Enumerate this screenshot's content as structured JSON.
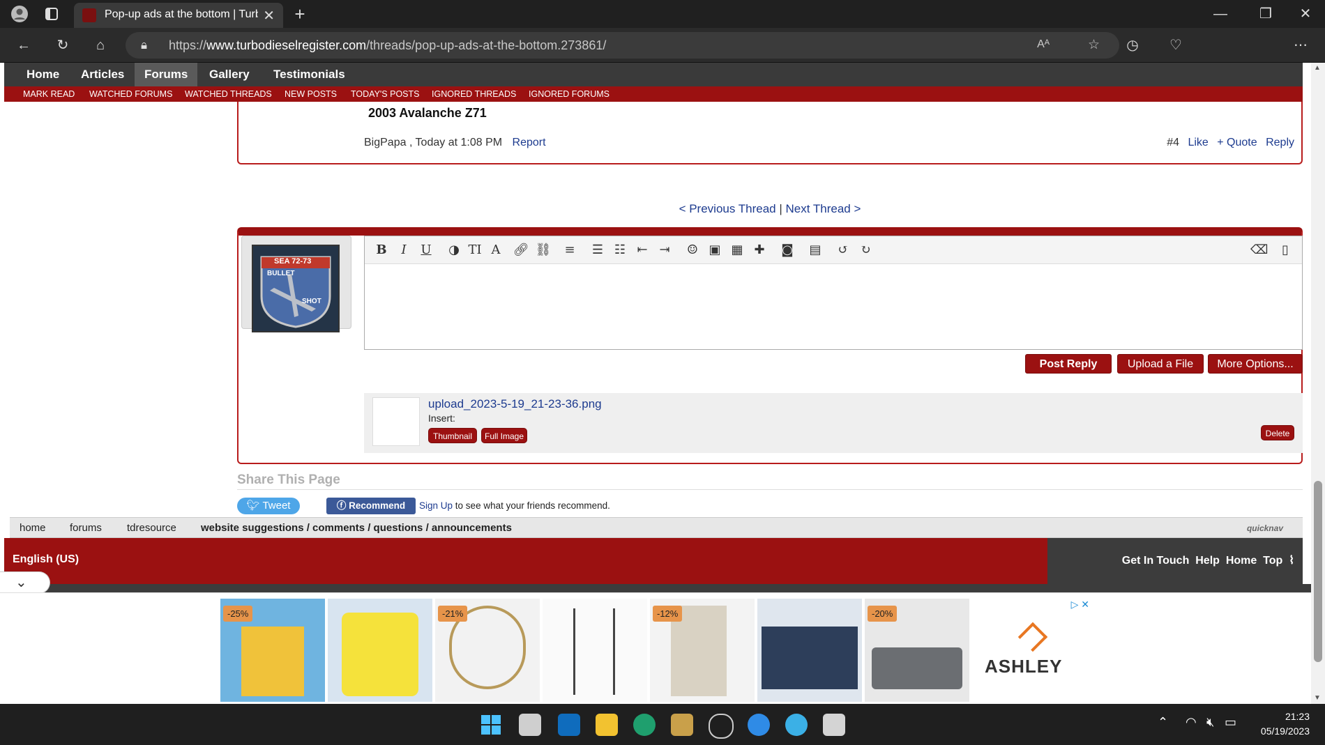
{
  "browser": {
    "tab_title": "Pop-up ads at the bottom | Turb",
    "url_prefix": "https://",
    "url_domain": "www.turbodieselregister.com",
    "url_path": "/threads/pop-up-ads-at-the-bottom.273861/",
    "read_aloud_label": "A͢"
  },
  "nav": {
    "items": [
      "Home",
      "Articles",
      "Forums",
      "Gallery",
      "Testimonials"
    ],
    "active": "Forums",
    "sub": [
      "MARK READ",
      "WATCHED FORUMS",
      "WATCHED THREADS",
      "NEW POSTS",
      "TODAY'S POSTS",
      "IGNORED THREADS",
      "IGNORED FORUMS"
    ]
  },
  "post": {
    "signature": "2003 Avalanche Z71",
    "author": "BigPapa",
    "time": "Today at 1:08 PM",
    "report": "Report",
    "number": "#4",
    "like": "Like",
    "quote": "+ Quote",
    "reply": "Reply"
  },
  "thread_nav": {
    "prev": "< Previous Thread",
    "sep": "|",
    "next": "Next Thread >"
  },
  "reply": {
    "avatar_text_top": "SEA 72-73",
    "avatar_text_1": "BULLET",
    "avatar_text_2": "SHOT",
    "post_reply": "Post Reply",
    "upload": "Upload a File",
    "more": "More Options...",
    "attachment": {
      "filename": "upload_2023-5-19_21-23-36.png",
      "insert_label": "Insert:",
      "thumbnail": "Thumbnail",
      "full_image": "Full Image",
      "delete": "Delete"
    }
  },
  "share": {
    "title": "Share This Page",
    "tweet": "Tweet",
    "recommend": "Recommend",
    "sign_up": "Sign Up",
    "fb_text": "to see what your friends recommend."
  },
  "breadcrumb": {
    "items": [
      "home",
      "forums",
      "tdresource",
      "website suggestions / comments / questions / announcements"
    ],
    "quicknav": "quicknav"
  },
  "footer": {
    "language": "English (US)",
    "links": [
      "Get In Touch",
      "Help",
      "Home",
      "Top"
    ]
  },
  "ads": {
    "badges": [
      "-25%",
      "-21%",
      "-12%",
      "-20%"
    ],
    "brand": "ASHLEY"
  },
  "taskbar": {
    "time": "21:23",
    "date": "05/19/2023"
  }
}
